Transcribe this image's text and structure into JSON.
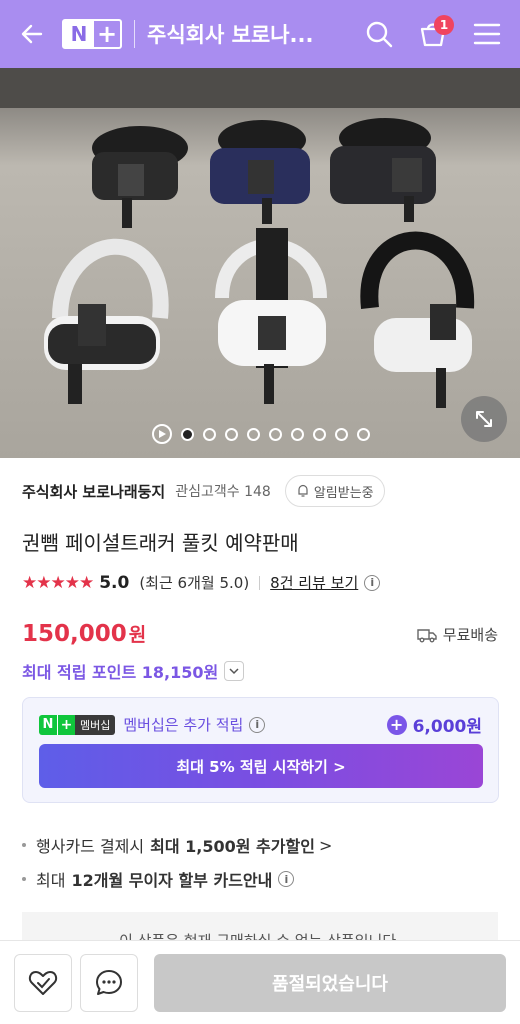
{
  "header": {
    "logo_n": "N",
    "logo_plus": "+",
    "store_title": "주식회사 보로나...",
    "cart_count": "1"
  },
  "gallery": {
    "total_images": 9,
    "active_index": 0
  },
  "seller": {
    "name": "주식회사 보로나래둥지",
    "fav_label": "관심고객수 148",
    "alarm_label": "알림받는중"
  },
  "product": {
    "title": "권뺌 페이셜트래커 풀킷 예약판매",
    "stars": "★★★★★",
    "score": "5.0",
    "recent_score": "(최근 6개월 5.0)",
    "review_link": "8건 리뷰 보기",
    "price": "150,000",
    "price_unit": "원",
    "shipping": "무료배송",
    "points": "최대 적립 포인트 18,150원"
  },
  "membership": {
    "logo_n": "N",
    "logo_plus": "+",
    "logo_text": "멤버십",
    "text": "멤버십은 추가 적립",
    "points": "6,000원",
    "cta": "최대 5% 적립 시작하기 >"
  },
  "benefits": [
    {
      "prefix": "행사카드 결제시",
      "bold": "최대 1,500원 추가할인",
      "suffix": ">"
    },
    {
      "prefix": "최대",
      "bold": "12개월 무이자 할부 카드안내",
      "suffix": "i"
    }
  ],
  "soldout_note": "이 상품은 현재 구매하실 수 없는 상품입니다.",
  "bottom": {
    "buy_label": "품절되었습니다"
  }
}
